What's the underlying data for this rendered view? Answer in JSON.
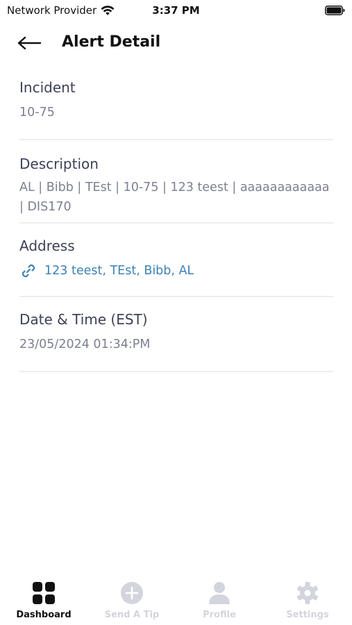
{
  "status_bar": {
    "carrier": "Network Provider",
    "time": "3:37 PM"
  },
  "header": {
    "title": "Alert Detail"
  },
  "details": {
    "incident": {
      "label": "Incident",
      "value": "10-75"
    },
    "description": {
      "label": "Description",
      "value": "AL | Bibb | TEst | 10-75 | 123 teest | aaaaaaaaaaaa | DIS170"
    },
    "address": {
      "label": "Address",
      "value": "123 teest, TEst, Bibb, AL"
    },
    "datetime": {
      "label": "Date & Time (EST)",
      "value": "23/05/2024 01:34:PM"
    }
  },
  "bottom_nav": {
    "items": [
      {
        "label": "Dashboard",
        "icon": "grid-icon",
        "active": true
      },
      {
        "label": "Send A Tip",
        "icon": "plus-circle-icon",
        "active": false
      },
      {
        "label": "Profile",
        "icon": "user-icon",
        "active": false
      },
      {
        "label": "Settings",
        "icon": "gear-icon",
        "active": false
      }
    ]
  },
  "colors": {
    "link": "#3d82b5",
    "label": "#3c4156",
    "value": "#7c8090",
    "divider": "#eceef2",
    "nav_inactive": "#d3d5dd",
    "nav_active": "#111111"
  }
}
